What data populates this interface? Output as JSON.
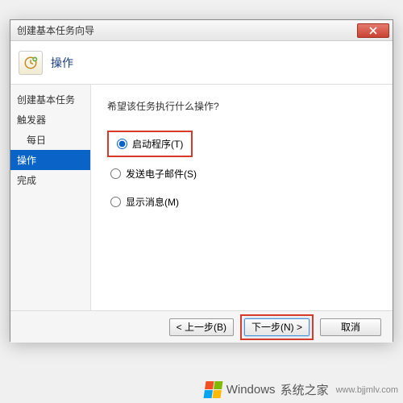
{
  "window": {
    "title": "创建基本任务向导"
  },
  "header": {
    "title": "操作"
  },
  "sidebar": {
    "items": [
      {
        "label": "创建基本任务"
      },
      {
        "label": "触发器"
      },
      {
        "label": "每日"
      },
      {
        "label": "操作"
      },
      {
        "label": "完成"
      }
    ]
  },
  "content": {
    "question": "希望该任务执行什么操作?",
    "options": [
      {
        "label": "启动程序(T)",
        "checked": true
      },
      {
        "label": "发送电子邮件(S)",
        "checked": false
      },
      {
        "label": "显示消息(M)",
        "checked": false
      }
    ]
  },
  "footer": {
    "back": "< 上一步(B)",
    "next": "下一步(N) >",
    "cancel": "取消"
  },
  "watermark": {
    "brand": "Windows",
    "suffix": "系统之家",
    "url": "www.bjjmlv.com"
  }
}
